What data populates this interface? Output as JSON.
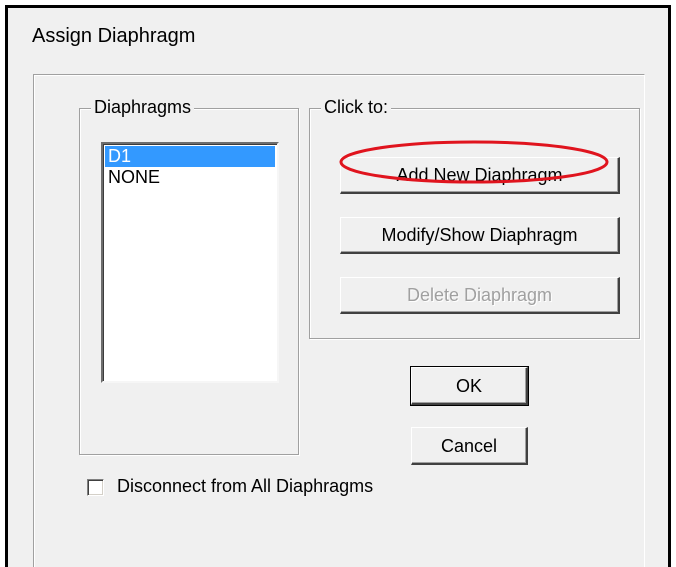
{
  "window": {
    "title": "Assign Diaphragm"
  },
  "diaphragms_group": {
    "label": "Diaphragms",
    "items": [
      {
        "label": "D1",
        "selected": true
      },
      {
        "label": "NONE",
        "selected": false
      }
    ]
  },
  "click_to_group": {
    "label": "Click to:",
    "add_button": "Add New Diaphragm",
    "modify_button": "Modify/Show Diaphragm",
    "delete_button": "Delete Diaphragm",
    "delete_enabled": false
  },
  "ok_button": "OK",
  "cancel_button": "Cancel",
  "disconnect_checkbox": {
    "label": "Disconnect from All Diaphragms",
    "checked": false
  },
  "annotation": {
    "color": "#e0141e",
    "target": "add-new-diaphragm-button"
  },
  "colors": {
    "selection": "#3399ff",
    "dialog_background": "#f0f0f0"
  }
}
